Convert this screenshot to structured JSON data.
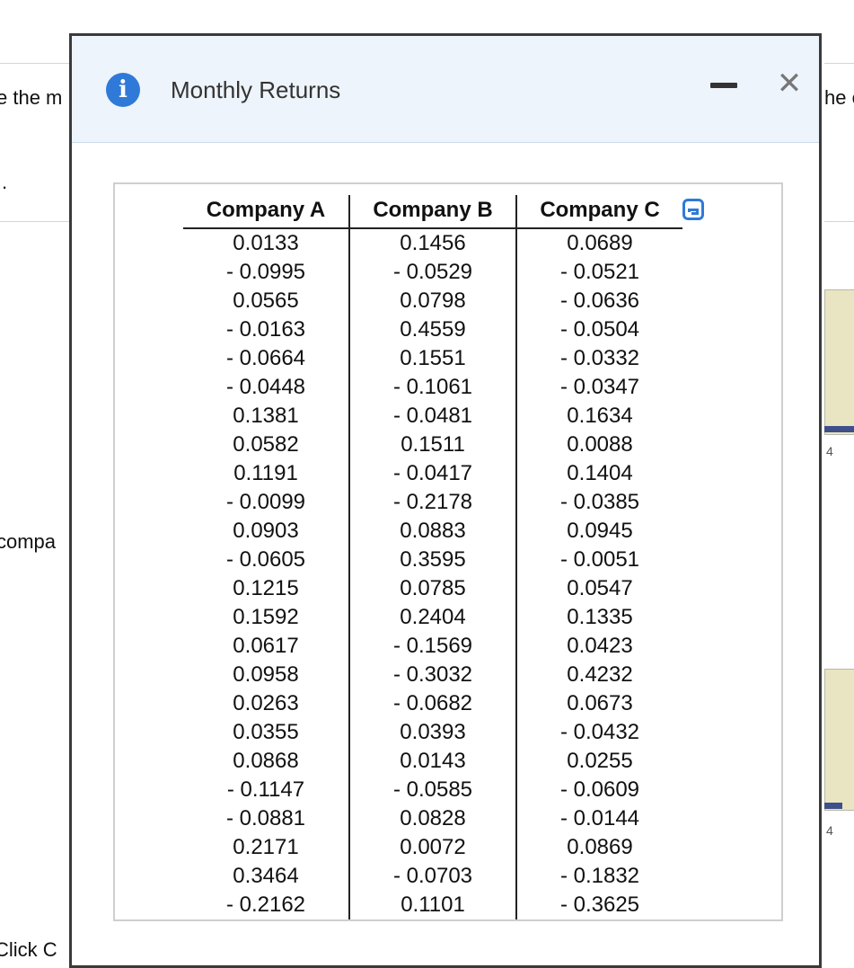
{
  "background": {
    "left_text_1": "e the m",
    "right_text_1": "he e",
    "left_text_2": ".",
    "left_text_3": "compa",
    "right_tick_1": "4",
    "right_tick_2": "4",
    "bottom_text": "Click C"
  },
  "dialog": {
    "title": "Monthly Returns",
    "icons": {
      "info": "info-icon",
      "minimize": "minimize-icon",
      "close": "close-icon",
      "copy": "copy-icon"
    },
    "info_glyph": "i",
    "close_glyph": "✕"
  },
  "table": {
    "headers": [
      "Company A",
      "Company B",
      "Company C"
    ],
    "rows": [
      [
        "0.0133",
        "0.1456",
        "0.0689"
      ],
      [
        "- 0.0995",
        "- 0.0529",
        "- 0.0521"
      ],
      [
        "0.0565",
        "0.0798",
        "- 0.0636"
      ],
      [
        "- 0.0163",
        "0.4559",
        "- 0.0504"
      ],
      [
        "- 0.0664",
        "0.1551",
        "- 0.0332"
      ],
      [
        "- 0.0448",
        "- 0.1061",
        "- 0.0347"
      ],
      [
        "0.1381",
        "- 0.0481",
        "0.1634"
      ],
      [
        "0.0582",
        "0.1511",
        "0.0088"
      ],
      [
        "0.1191",
        "- 0.0417",
        "0.1404"
      ],
      [
        "- 0.0099",
        "- 0.2178",
        "- 0.0385"
      ],
      [
        "0.0903",
        "0.0883",
        "0.0945"
      ],
      [
        "- 0.0605",
        "0.3595",
        "- 0.0051"
      ],
      [
        "0.1215",
        "0.0785",
        "0.0547"
      ],
      [
        "0.1592",
        "0.2404",
        "0.1335"
      ],
      [
        "0.0617",
        "- 0.1569",
        "0.0423"
      ],
      [
        "0.0958",
        "- 0.3032",
        "0.4232"
      ],
      [
        "0.0263",
        "- 0.0682",
        "0.0673"
      ],
      [
        "0.0355",
        "0.0393",
        "- 0.0432"
      ],
      [
        "0.0868",
        "0.0143",
        "0.0255"
      ],
      [
        "- 0.1147",
        "- 0.0585",
        "- 0.0609"
      ],
      [
        "- 0.0881",
        "0.0828",
        "- 0.0144"
      ],
      [
        "0.2171",
        "0.0072",
        "0.0869"
      ],
      [
        "0.3464",
        "- 0.0703",
        "- 0.1832"
      ],
      [
        "- 0.2162",
        "0.1101",
        "- 0.3625"
      ]
    ]
  }
}
